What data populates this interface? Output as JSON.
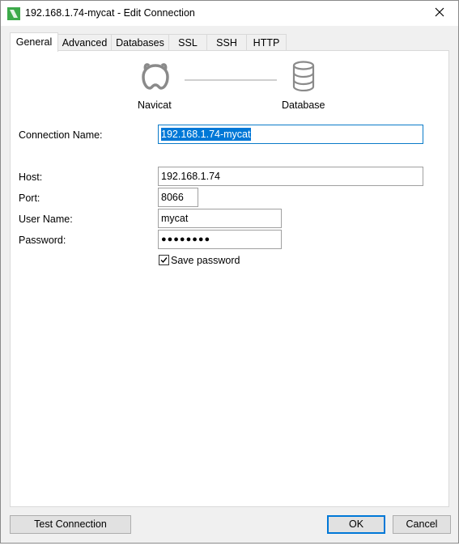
{
  "window": {
    "title": "192.168.1.74-mycat - Edit Connection"
  },
  "tabs": [
    {
      "label": "General"
    },
    {
      "label": "Advanced"
    },
    {
      "label": "Databases"
    },
    {
      "label": "SSL"
    },
    {
      "label": "SSH"
    },
    {
      "label": "HTTP"
    }
  ],
  "header": {
    "left_label": "Navicat",
    "right_label": "Database",
    "left_icon": "navicat-icon",
    "right_icon": "database-icon"
  },
  "form": {
    "connection_name_label": "Connection Name:",
    "connection_name_value": "192.168.1.74-mycat",
    "host_label": "Host:",
    "host_value": "192.168.1.74",
    "port_label": "Port:",
    "port_value": "8066",
    "username_label": "User Name:",
    "username_value": "mycat",
    "password_label": "Password:",
    "password_value": "●●●●●●●●",
    "save_password_label": "Save password",
    "save_password_checked": true
  },
  "buttons": {
    "test_connection": "Test Connection",
    "ok": "OK",
    "cancel": "Cancel"
  },
  "colors": {
    "accent": "#0078d7",
    "selection": "#0078d7",
    "brand_green": "#3daa4a"
  }
}
